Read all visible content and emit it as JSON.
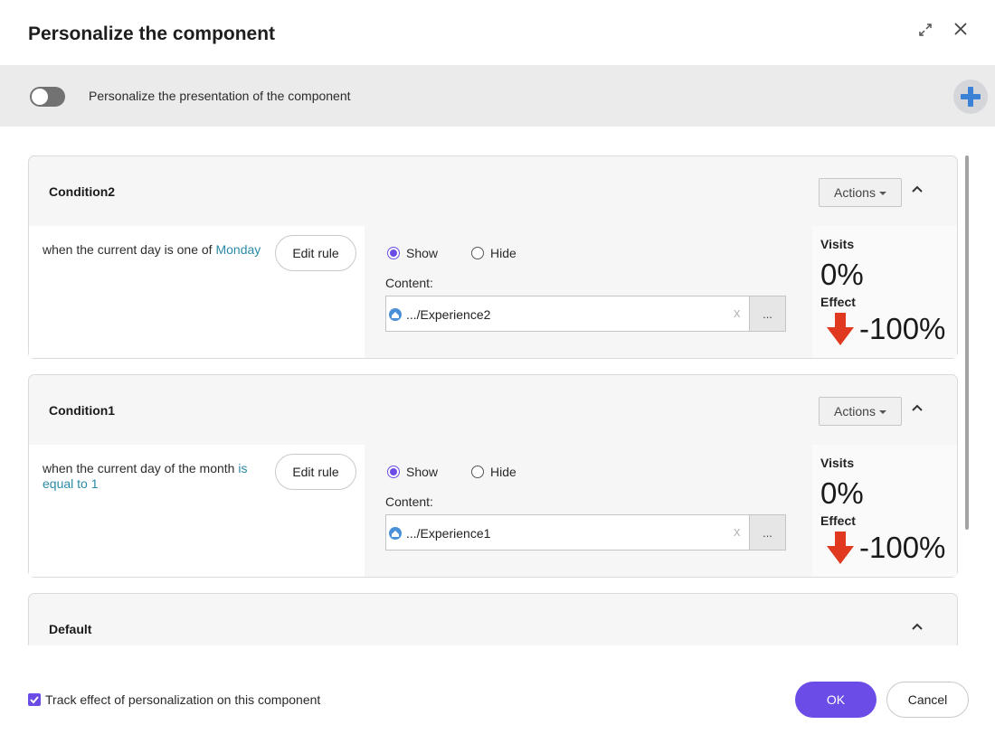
{
  "dialog": {
    "title": "Personalize the component"
  },
  "toggle_bar": {
    "label": "Personalize the presentation of the component",
    "enabled": false
  },
  "conditions": [
    {
      "title": "Condition2",
      "actions_label": "Actions",
      "rule_prefix": "when the current day is one of ",
      "rule_link": "Monday",
      "edit_rule_label": "Edit rule",
      "show_label": "Show",
      "hide_label": "Hide",
      "selected": "Show",
      "content_label": "Content:",
      "content_value": ".../Experience2",
      "clear_label": "x",
      "browse_label": "...",
      "visits_label": "Visits",
      "visits_value": "0%",
      "effect_label": "Effect",
      "effect_value": "-100%"
    },
    {
      "title": "Condition1",
      "actions_label": "Actions",
      "rule_prefix": "when the current day of the month ",
      "rule_link": "is equal to 1",
      "edit_rule_label": "Edit rule",
      "show_label": "Show",
      "hide_label": "Hide",
      "selected": "Show",
      "content_label": "Content:",
      "content_value": ".../Experience1",
      "clear_label": "x",
      "browse_label": "...",
      "visits_label": "Visits",
      "visits_value": "0%",
      "effect_label": "Effect",
      "effect_value": "-100%"
    }
  ],
  "default_card": {
    "title": "Default"
  },
  "footer": {
    "track_label": "Track effect of personalization on this component",
    "track_checked": true,
    "ok_label": "OK",
    "cancel_label": "Cancel"
  },
  "colors": {
    "accent": "#6b4ce6",
    "link": "#2b8aa6",
    "effect_arrow": "#e0391f",
    "add_icon": "#3b82d6"
  }
}
